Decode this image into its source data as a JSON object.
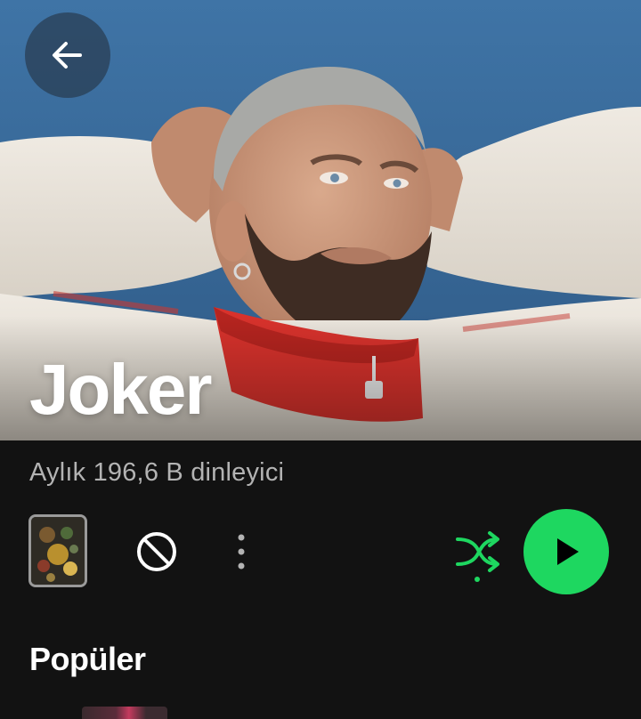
{
  "hero": {
    "artist_name": "Joker"
  },
  "stats": {
    "monthly_listeners": "Aylık 196,6 B dinleyici"
  },
  "actions": {
    "back_icon": "arrow-left-icon",
    "block_icon": "block-icon",
    "more_icon": "more-vertical-icon",
    "shuffle_icon": "shuffle-icon",
    "play_icon": "play-icon"
  },
  "popular": {
    "title": "Popüler"
  },
  "colors": {
    "accent": "#1ed760",
    "background": "#121212",
    "secondary_text": "#b3b3b3"
  }
}
